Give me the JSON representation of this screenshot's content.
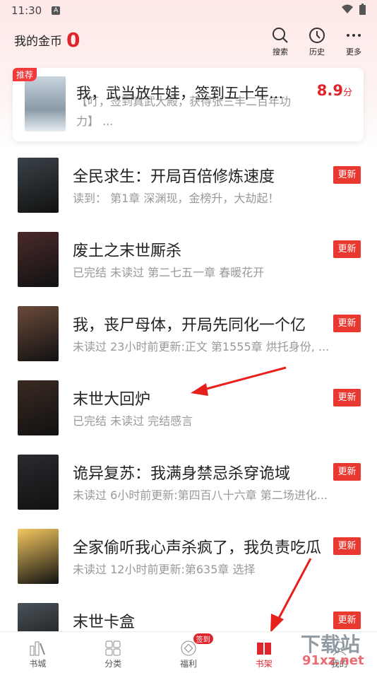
{
  "status": {
    "time": "11:30"
  },
  "header": {
    "coins_label": "我的金币",
    "coins_value": "0",
    "search": "搜索",
    "history": "历史",
    "more": "更多"
  },
  "featured": {
    "tag": "推荐",
    "title": "我，武当放牛娃，签到五十年...",
    "desc": "【叮，签到真武大殿，获得张三丰二百年功力】 ...",
    "score": "8.9",
    "score_unit": "分"
  },
  "books": [
    {
      "title": "全民求生：开局百倍修炼速度",
      "info": "读到： 第1章 深渊现，金榜升，大劫起！",
      "badge": "更新",
      "color": "#3a4248"
    },
    {
      "title": "废土之末世厮杀",
      "info": "已完结 未读过 第二七五一章 春暖花开",
      "badge": "更新",
      "color": "#4a2a2a"
    },
    {
      "title": "我，丧尸母体，开局先同化一个亿",
      "info": "未读过 23小时前更新:正文 第1555章 烘托身份, ...",
      "badge": "更新",
      "color": "#6a4a3a"
    },
    {
      "title": "末世大回炉",
      "info": "已完结 未读过 完结感言",
      "badge": "更新",
      "color": "#3a2a22"
    },
    {
      "title": "诡异复苏：我满身禁忌杀穿诡域",
      "info": "未读过 6小时前更新:第四百八十六章 第二场进化...",
      "badge": "更新",
      "color": "#2a2a30"
    },
    {
      "title": "全家偷听我心声杀疯了，我负责吃瓜",
      "info": "未读过 12小时前更新:第635章 选择",
      "badge": "更新",
      "color": "#f4c860"
    },
    {
      "title": "末世卡盒",
      "info": "",
      "badge": "更新",
      "color": "#4a5258"
    }
  ],
  "nav": {
    "tabs": [
      "书城",
      "分类",
      "福利",
      "书架",
      "我的"
    ],
    "sign_badge": "签到",
    "active": "书架"
  },
  "watermark": {
    "text1": "下载站",
    "text2": "91xz.net"
  },
  "colors": {
    "accent": "#e0242c"
  }
}
